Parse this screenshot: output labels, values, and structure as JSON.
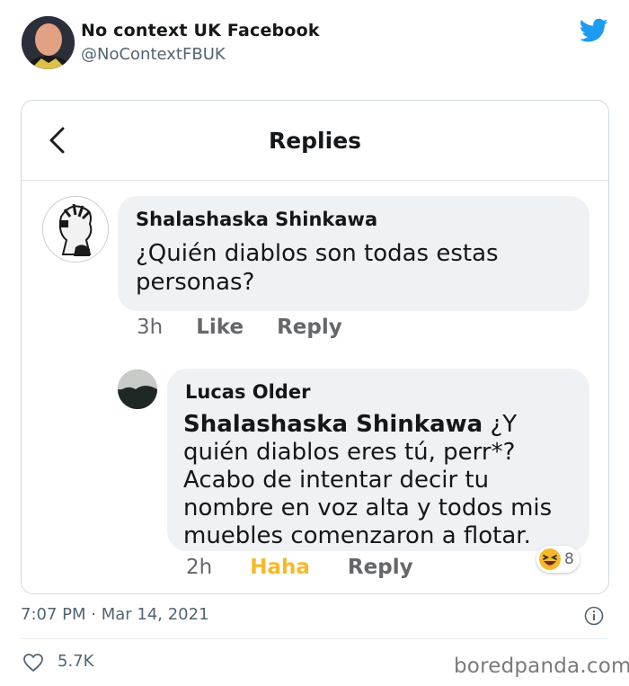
{
  "tweet": {
    "author_name": "No context UK Facebook",
    "author_handle": "@NoContextFBUK",
    "timestamp": "7:07 PM · Mar 14, 2021",
    "likes": "5.7K",
    "brand_color": "#1d9bf0"
  },
  "screenshot": {
    "title": "Replies",
    "comments": [
      {
        "author": "Shalashaska Shinkawa",
        "text": "¿Quién diablos son todas estas personas?",
        "time": "3h",
        "like_label": "Like",
        "reply_label": "Reply"
      },
      {
        "author": "Lucas Older",
        "mention": "Shalashaska Shinkawa",
        "text": "¿Y quién diablos eres tú, perr*? Acabo de intentar decir tu nombre en voz alta y todos mis muebles comenzaron a flotar.",
        "time": "2h",
        "reaction_label": "Haha",
        "reply_label": "Reply",
        "reaction_count": "8",
        "reaction_color": "#f7b928"
      }
    ]
  },
  "watermark": "boredpanda.com"
}
